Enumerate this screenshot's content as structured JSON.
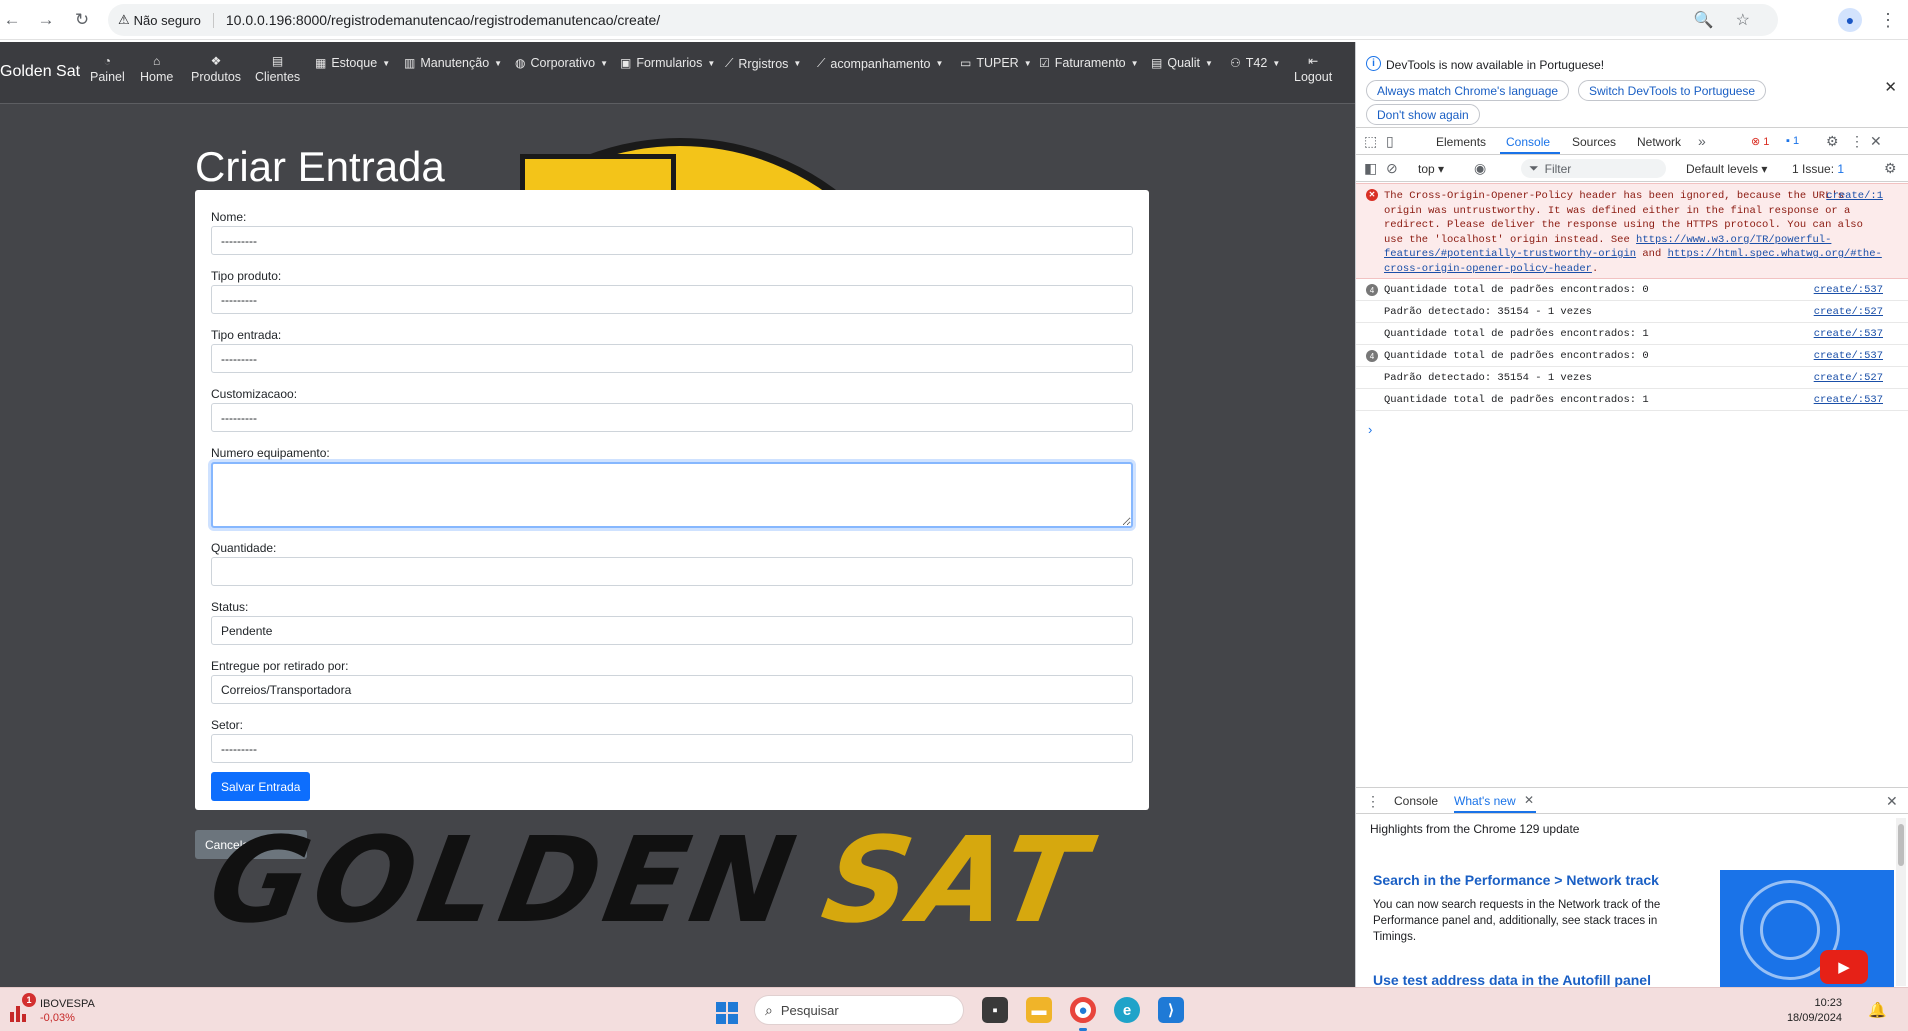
{
  "browser": {
    "security_label": "Não seguro",
    "url": "10.0.0.196:8000/registrodemanutencao/registrodemanutencao/create/"
  },
  "nav": {
    "brand": "Golden Sat",
    "stack_items": [
      {
        "label": "Painel",
        "icon": "dashboard-icon"
      },
      {
        "label": "Home",
        "icon": "home-icon"
      },
      {
        "label": "Produtos",
        "icon": "boxes-icon"
      },
      {
        "label": "Clientes",
        "icon": "clients-icon"
      }
    ],
    "dropdowns": [
      {
        "label": "Estoque",
        "icon": "table-icon"
      },
      {
        "label": "Manutenção",
        "icon": "building-icon"
      },
      {
        "label": "Corporativo",
        "icon": "globe-icon"
      },
      {
        "label": "Formularios",
        "icon": "form-icon"
      },
      {
        "label": "Rrgistros",
        "icon": "chart-line-icon"
      },
      {
        "label": "acompanhamento",
        "icon": "chart-line-icon"
      },
      {
        "label": "TUPER",
        "icon": "folder-icon"
      },
      {
        "label": "Faturamento",
        "icon": "check-square-icon"
      },
      {
        "label": "Qualit",
        "icon": "card-icon"
      },
      {
        "label": "T42",
        "icon": "network-icon"
      }
    ],
    "logout": "Logout"
  },
  "page": {
    "title": "Criar Entrada",
    "background_logo": {
      "word1": "GOLDEN",
      "word2": "SAT"
    }
  },
  "form": {
    "fields": [
      {
        "label": "Nome:",
        "value": "---------"
      },
      {
        "label": "Tipo produto:",
        "value": "---------"
      },
      {
        "label": "Tipo entrada:",
        "value": "---------"
      },
      {
        "label": "Customizacaoo:",
        "value": "---------"
      },
      {
        "label": "Numero equipamento:",
        "value": ""
      },
      {
        "label": "Quantidade:",
        "value": ""
      },
      {
        "label": "Status:",
        "value": "Pendente"
      },
      {
        "label": "Entregue por retirado por:",
        "value": "Correios/Transportadora"
      },
      {
        "label": "Setor:",
        "value": "---------"
      }
    ],
    "save_button": "Salvar Entrada",
    "cancel_button": "Cancelar e Voltar"
  },
  "devtools": {
    "banner": {
      "message": "DevTools is now available in Portuguese!",
      "btn_match": "Always match Chrome's language",
      "btn_switch": "Switch DevTools to Portuguese",
      "btn_dont_show": "Don't show again"
    },
    "tabs": [
      "Elements",
      "Console",
      "Sources",
      "Network"
    ],
    "active_tab": "Console",
    "error_count": "1",
    "msg_count": "1",
    "toolbar": {
      "context": "top",
      "filter_placeholder": "Filter",
      "levels": "Default levels",
      "issues": "1 Issue:",
      "issues_count": "1"
    },
    "error": {
      "text1": "The Cross-Origin-Opener-Policy header has been ignored, because the URL's origin was untrustworthy. It was defined either in the final response or a redirect. Please deliver the response using the HTTPS protocol. You can also use the 'localhost' origin instead. See ",
      "link1": "https://www.w3.org/TR/powerful-features/#potentially-trustworthy-origin",
      "text2": " and ",
      "link2": "https://html.spec.whatwg.org/#the-cross-origin-opener-policy-header",
      "text3": ".",
      "source": "create/:1"
    },
    "logs": [
      {
        "badge": "4",
        "text": "Quantidade total de padrões encontrados: 0",
        "source": "create/:537"
      },
      {
        "badge": "",
        "text": "Padrão detectado: 35154 - 1 vezes",
        "source": "create/:527"
      },
      {
        "badge": "",
        "text": "Quantidade total de padrões encontrados: 1",
        "source": "create/:537"
      },
      {
        "badge": "4",
        "text": "Quantidade total de padrões encontrados: 0",
        "source": "create/:537"
      },
      {
        "badge": "",
        "text": "Padrão detectado: 35154 - 1 vezes",
        "source": "create/:527"
      },
      {
        "badge": "",
        "text": "Quantidade total de padrões encontrados: 1",
        "source": "create/:537"
      }
    ],
    "drawer": {
      "tab_console": "Console",
      "tab_whats_new": "What's new",
      "subtitle": "Highlights from the Chrome 129 update",
      "item1_title": "Search in the Performance > Network track",
      "item1_text": "You can now search requests in the Network track of the Performance panel and, additionally, see stack traces in Timings.",
      "item2_title": "Use test address data in the Autofill panel"
    }
  },
  "taskbar": {
    "stock_name": "IBOVESPA",
    "stock_change": "-0,03%",
    "stock_badge": "1",
    "search_placeholder": "Pesquisar",
    "time": "10:23",
    "date": "18/09/2024"
  }
}
